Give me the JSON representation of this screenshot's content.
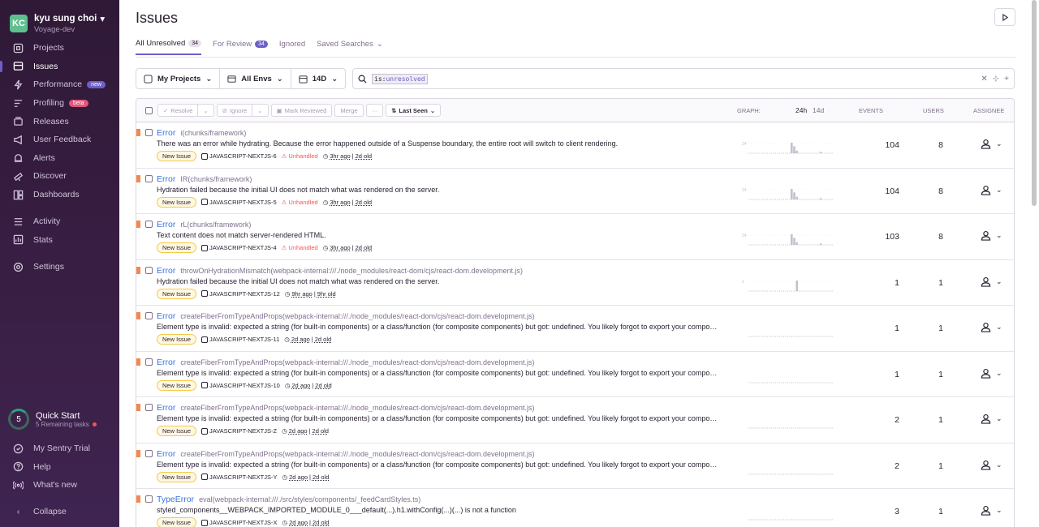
{
  "org": {
    "initials": "KC",
    "name": "kyu sung choi",
    "project": "Voyage-dev"
  },
  "nav": {
    "main": [
      {
        "label": "Projects",
        "icon": "projects-icon"
      },
      {
        "label": "Issues",
        "icon": "issues-icon",
        "active": true
      },
      {
        "label": "Performance",
        "icon": "lightning-icon",
        "badge": "new"
      },
      {
        "label": "Profiling",
        "icon": "profiling-icon",
        "badge": "beta"
      },
      {
        "label": "Releases",
        "icon": "releases-icon"
      },
      {
        "label": "User Feedback",
        "icon": "megaphone-icon"
      },
      {
        "label": "Alerts",
        "icon": "siren-icon"
      },
      {
        "label": "Discover",
        "icon": "telescope-icon"
      },
      {
        "label": "Dashboards",
        "icon": "dashboard-icon"
      }
    ],
    "secondary": [
      {
        "label": "Activity",
        "icon": "activity-icon"
      },
      {
        "label": "Stats",
        "icon": "stats-icon"
      }
    ],
    "settings": {
      "label": "Settings",
      "icon": "gear-icon"
    },
    "bottom": [
      {
        "label": "My Sentry Trial",
        "icon": "trial-icon"
      },
      {
        "label": "Help",
        "icon": "help-icon"
      },
      {
        "label": "What's new",
        "icon": "broadcast-icon"
      }
    ],
    "collapse": "Collapse"
  },
  "quick_start": {
    "count": "5",
    "title": "Quick Start",
    "subtitle": "5 Remaining tasks"
  },
  "page": {
    "title": "Issues"
  },
  "tabs": [
    {
      "label": "All Unresolved",
      "count": "34",
      "active": true
    },
    {
      "label": "For Review",
      "count": "34"
    },
    {
      "label": "Ignored"
    },
    {
      "label": "Saved Searches"
    }
  ],
  "filters": {
    "projects": "My Projects",
    "envs": "All Envs",
    "period": "14D"
  },
  "search": {
    "key": "is:",
    "value": "unresolved"
  },
  "table_header": {
    "resolve": "Resolve",
    "ignore": "Ignore",
    "mark_reviewed": "Mark Reviewed",
    "merge": "Merge",
    "more": "···",
    "sort": "Last Seen",
    "graph": "GRAPH:",
    "graph_24h": "24h",
    "graph_14d": "14d",
    "events": "EVENTS",
    "users": "USERS",
    "assignee": "ASSIGNEE"
  },
  "issues": [
    {
      "type": "Error",
      "location": "i(chunks/framework)",
      "message": "There was an error while hydrating. Because the error happened outside of a Suspense boundary, the entire root will switch to client rendering.",
      "status": "New Issue",
      "project": "JAVASCRIPT-NEXTJS-6",
      "unhandled": "Unhandled",
      "last_seen": "3hr ago",
      "first_seen": "2d old",
      "events": "104",
      "users": "8",
      "graph_max": "24",
      "bars": [
        0,
        0,
        0,
        0,
        0,
        0,
        0,
        0,
        0,
        0,
        0,
        0,
        0,
        0,
        0,
        0,
        24,
        16,
        6,
        0,
        0,
        0,
        0,
        0,
        0,
        0,
        0,
        3,
        0,
        0,
        0,
        0
      ]
    },
    {
      "type": "Error",
      "location": "IR(chunks/framework)",
      "message": "Hydration failed because the initial UI does not match what was rendered on the server.",
      "status": "New Issue",
      "project": "JAVASCRIPT-NEXTJS-5",
      "unhandled": "Unhandled",
      "last_seen": "3hr ago",
      "first_seen": "2d old",
      "events": "104",
      "users": "8",
      "graph_max": "24",
      "bars": [
        0,
        0,
        0,
        0,
        0,
        0,
        0,
        0,
        0,
        0,
        0,
        0,
        0,
        0,
        0,
        0,
        24,
        16,
        6,
        0,
        0,
        0,
        0,
        0,
        0,
        0,
        0,
        3,
        0,
        0,
        0,
        0
      ]
    },
    {
      "type": "Error",
      "location": "rL(chunks/framework)",
      "message": "Text content does not match server-rendered HTML.",
      "status": "New Issue",
      "project": "JAVASCRIPT-NEXTJS-4",
      "unhandled": "Unhandled",
      "last_seen": "3hr ago",
      "first_seen": "2d old",
      "events": "103",
      "users": "8",
      "graph_max": "24",
      "bars": [
        0,
        0,
        0,
        0,
        0,
        0,
        0,
        0,
        0,
        0,
        0,
        0,
        0,
        0,
        0,
        0,
        24,
        16,
        6,
        0,
        0,
        0,
        0,
        0,
        0,
        0,
        0,
        3,
        0,
        0,
        0,
        0
      ]
    },
    {
      "type": "Error",
      "location": "throwOnHydrationMismatch(webpack-internal:///./node_modules/react-dom/cjs/react-dom.development.js)",
      "message": "Hydration failed because the initial UI does not match what was rendered on the server.",
      "status": "New Issue",
      "project": "JAVASCRIPT-NEXTJS-12",
      "unhandled": "",
      "last_seen": "9hr ago",
      "first_seen": "9hr old",
      "events": "1",
      "users": "1",
      "graph_max": "1",
      "bars": [
        0,
        0,
        0,
        0,
        0,
        0,
        0,
        0,
        0,
        0,
        0,
        0,
        0,
        0,
        0,
        0,
        0,
        0,
        1,
        0,
        0,
        0,
        0,
        0,
        0,
        0,
        0,
        0,
        0,
        0,
        0,
        0
      ]
    },
    {
      "type": "Error",
      "location": "createFiberFromTypeAndProps(webpack-internal:///./node_modules/react-dom/cjs/react-dom.development.js)",
      "message": "Element type is invalid: expected a string (for built-in components) or a class/function (for composite components) but got: undefined. You likely forgot to export your component from the file it's defined in.",
      "status": "New Issue",
      "project": "JAVASCRIPT-NEXTJS-11",
      "unhandled": "",
      "last_seen": "2d ago",
      "first_seen": "2d old",
      "events": "1",
      "users": "1",
      "graph_max": "",
      "bars": []
    },
    {
      "type": "Error",
      "location": "createFiberFromTypeAndProps(webpack-internal:///./node_modules/react-dom/cjs/react-dom.development.js)",
      "message": "Element type is invalid: expected a string (for built-in components) or a class/function (for composite components) but got: undefined. You likely forgot to export your component from the file it's defined in.",
      "status": "New Issue",
      "project": "JAVASCRIPT-NEXTJS-10",
      "unhandled": "",
      "last_seen": "2d ago",
      "first_seen": "2d old",
      "events": "1",
      "users": "1",
      "graph_max": "",
      "bars": []
    },
    {
      "type": "Error",
      "location": "createFiberFromTypeAndProps(webpack-internal:///./node_modules/react-dom/cjs/react-dom.development.js)",
      "message": "Element type is invalid: expected a string (for built-in components) or a class/function (for composite components) but got: undefined. You likely forgot to export your component from the file it's defined in.",
      "status": "New Issue",
      "project": "JAVASCRIPT-NEXTJS-Z",
      "unhandled": "",
      "last_seen": "2d ago",
      "first_seen": "2d old",
      "events": "2",
      "users": "1",
      "graph_max": "",
      "bars": []
    },
    {
      "type": "Error",
      "location": "createFiberFromTypeAndProps(webpack-internal:///./node_modules/react-dom/cjs/react-dom.development.js)",
      "message": "Element type is invalid: expected a string (for built-in components) or a class/function (for composite components) but got: undefined. You likely forgot to export your component from the file it's defined in.",
      "status": "New Issue",
      "project": "JAVASCRIPT-NEXTJS-Y",
      "unhandled": "",
      "last_seen": "2d ago",
      "first_seen": "2d old",
      "events": "2",
      "users": "1",
      "graph_max": "",
      "bars": []
    },
    {
      "type": "TypeError",
      "location": "eval(webpack-internal:///./src/styles/components/_feedCardStyles.ts)",
      "message": "styled_components__WEBPACK_IMPORTED_MODULE_0___default(...).h1.withConfig(...)(...) is not a function",
      "status": "New Issue",
      "project": "JAVASCRIPT-NEXTJS-X",
      "unhandled": "",
      "last_seen": "2d ago",
      "first_seen": "2d old",
      "events": "3",
      "users": "1",
      "graph_max": "",
      "bars": []
    }
  ],
  "colors": {
    "sidebar": "#2f1937",
    "accent": "#6c5fc7",
    "link": "#3c74dd",
    "level_error": "#f2894f",
    "unhandled": "#f55459"
  }
}
